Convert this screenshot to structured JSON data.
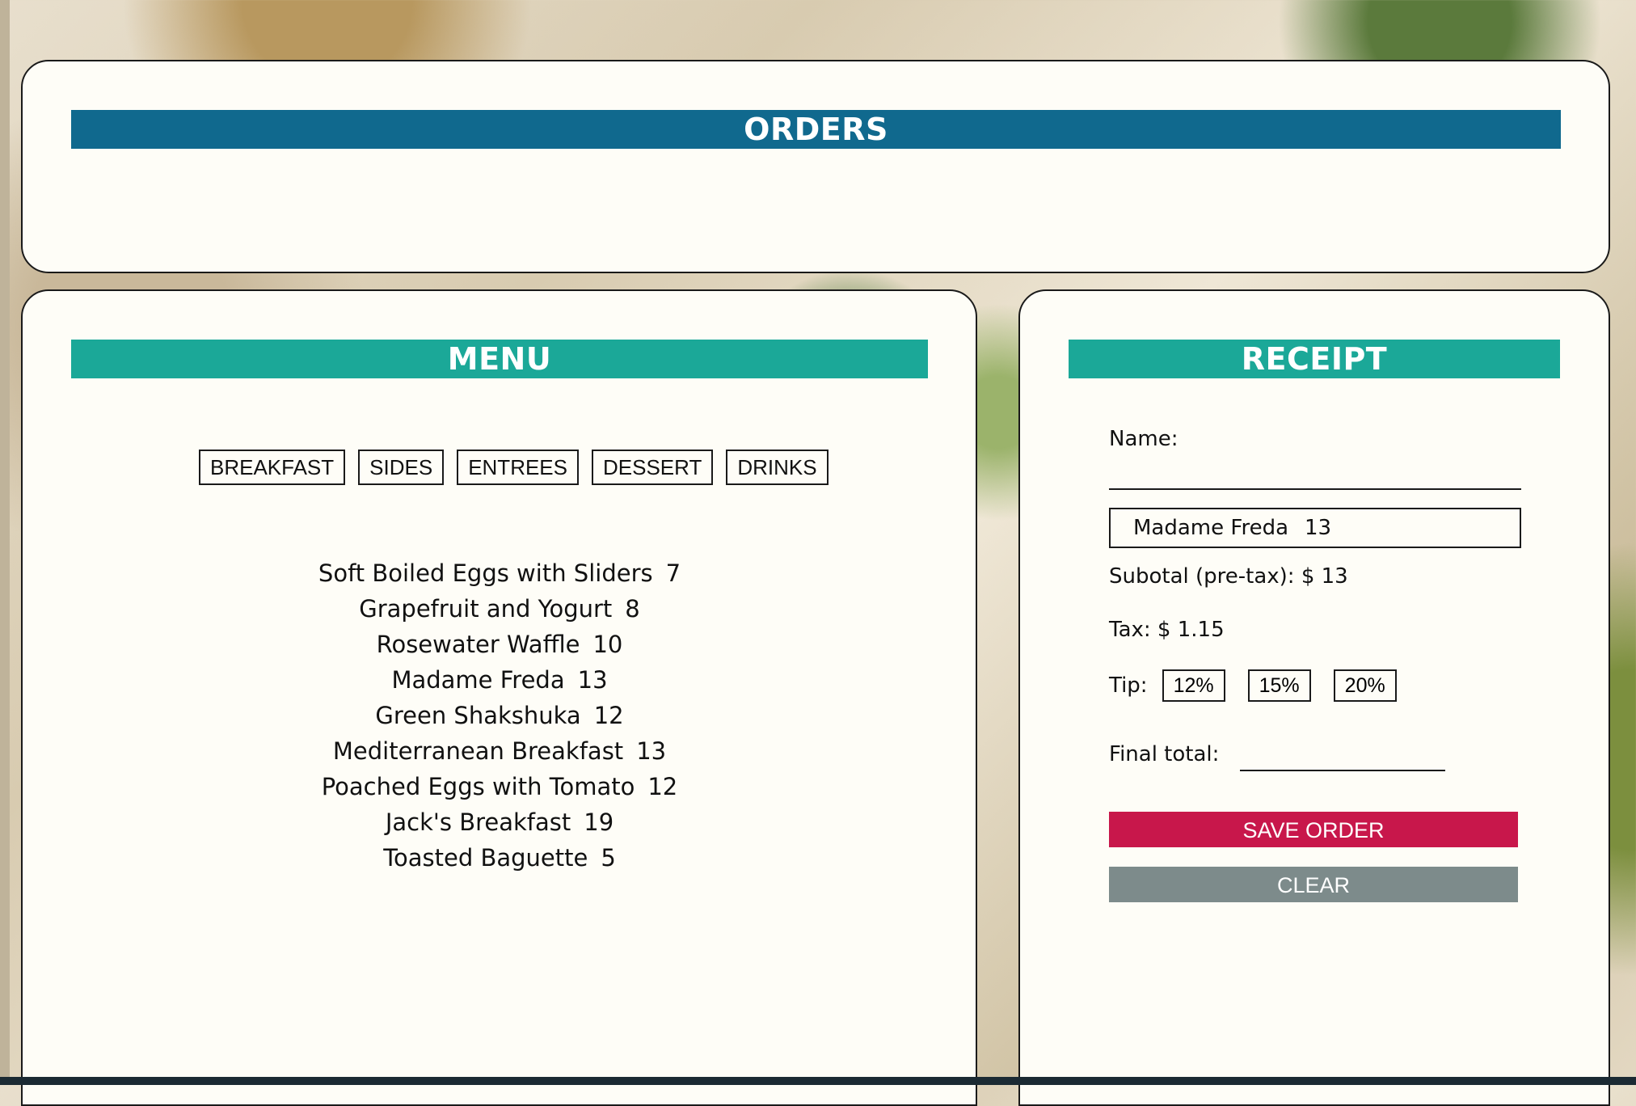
{
  "orders": {
    "title": "ORDERS"
  },
  "menu": {
    "title": "MENU",
    "tabs": [
      "BREAKFAST",
      "SIDES",
      "ENTREES",
      "DESSERT",
      "DRINKS"
    ],
    "items": [
      {
        "name": "Soft Boiled Eggs with Sliders",
        "price": "7"
      },
      {
        "name": "Grapefruit and Yogurt",
        "price": "8"
      },
      {
        "name": "Rosewater Waffle",
        "price": "10"
      },
      {
        "name": "Madame Freda",
        "price": "13"
      },
      {
        "name": "Green Shakshuka",
        "price": "12"
      },
      {
        "name": "Mediterranean Breakfast",
        "price": "13"
      },
      {
        "name": "Poached Eggs with Tomato",
        "price": "12"
      },
      {
        "name": "Jack's Breakfast",
        "price": "19"
      },
      {
        "name": "Toasted Baguette",
        "price": "5"
      }
    ]
  },
  "receipt": {
    "title": "RECEIPT",
    "name_label": "Name:",
    "name_value": "",
    "order_items": [
      {
        "name": "Madame Freda",
        "price": "13"
      }
    ],
    "subtotal_text": "Subotal (pre-tax): $ 13",
    "tax_text": "Tax: $ 1.15",
    "tip_label": "Tip:",
    "tip_options": [
      "12%",
      "15%",
      "20%"
    ],
    "final_total_label": "Final total:",
    "final_total_value": "",
    "save_label": "SAVE ORDER",
    "clear_label": "CLEAR"
  },
  "colors": {
    "orders_header": "#10698e",
    "section_header": "#1ba898",
    "save_button": "#c8174b",
    "clear_button": "#7d8b8b",
    "panel_background": "#fefdf7"
  }
}
